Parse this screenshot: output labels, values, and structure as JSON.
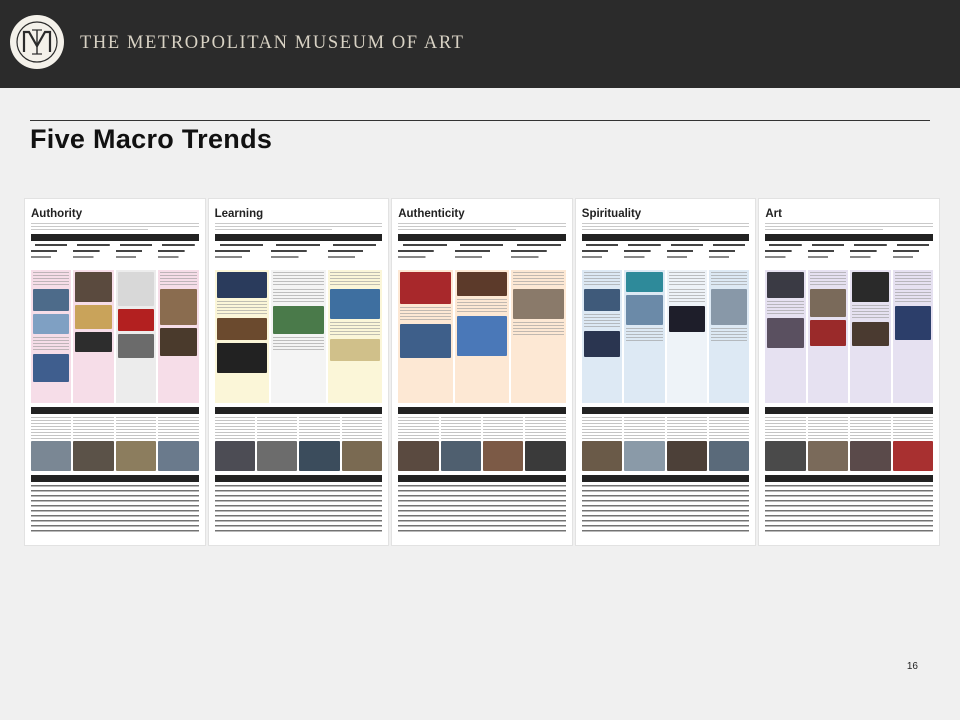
{
  "header": {
    "org_name": "THE METROPOLITAN MUSEUM OF ART",
    "logo_icon": "met-monogram-icon"
  },
  "slide": {
    "title": "Five Macro Trends",
    "page_number": "16"
  },
  "panels": [
    {
      "title": "Authority",
      "tint": "#f6dde8",
      "accent": "#c98aa6"
    },
    {
      "title": "Learning",
      "tint": "#fbf6d8",
      "accent": "#b8a84a"
    },
    {
      "title": "Authenticity",
      "tint": "#fde8d4",
      "accent": "#c9874a"
    },
    {
      "title": "Spirituality",
      "tint": "#dde9f4",
      "accent": "#6f93b8"
    },
    {
      "title": "Art",
      "tint": "#e6e1f1",
      "accent": "#8a7fb5"
    }
  ]
}
